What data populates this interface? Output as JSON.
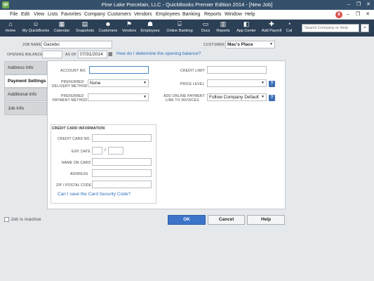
{
  "window": {
    "title": "Pine Lake Porcelain, LLC  - QuickBooks Premier Edition 2014 - [New Job]",
    "app_icon": "qb",
    "minimize": "–",
    "restore": "❐",
    "close": "✕"
  },
  "menu": {
    "items": [
      "File",
      "Edit",
      "View",
      "Lists",
      "Favorites",
      "Company",
      "Customers",
      "Vendors",
      "Employees",
      "Banking",
      "Reports",
      "Window",
      "Help"
    ],
    "alerts_count": "8",
    "right_controls": [
      "–",
      "❐",
      "✕"
    ]
  },
  "toolbar": {
    "items": [
      {
        "label": "Home",
        "icon": "⌂"
      },
      {
        "label": "My QuickBooks",
        "icon": "☺"
      },
      {
        "label": "Calendar",
        "icon": "▦"
      },
      {
        "label": "Snapshots",
        "icon": "▤"
      },
      {
        "label": "Customers",
        "icon": "☻"
      },
      {
        "label": "Vendors",
        "icon": "⚑"
      },
      {
        "label": "Employees",
        "icon": "☗"
      },
      {
        "label": "Online Banking",
        "icon": "⌸"
      },
      {
        "label": "Docs",
        "icon": "▭"
      },
      {
        "label": "Reports",
        "icon": "▥"
      },
      {
        "label": "App Center",
        "icon": "◧"
      },
      {
        "label": "Add Payroll",
        "icon": "✚"
      },
      {
        "label": "Cal",
        "icon": "◔"
      }
    ],
    "search_placeholder": "Search Company or Help",
    "search_button": "⌕"
  },
  "header": {
    "job_name_label": "JOB NAME",
    "job_name_value": "Gazebo",
    "customer_label": "CUSTOMER",
    "customer_value": "Mac's Place",
    "opening_balance_label": "OPENING BALANCE",
    "opening_balance_value": "",
    "as_of_label": "AS OF",
    "as_of_value": "07/31/2014",
    "calendar_icon": "▦",
    "help_link": "How do I determine the opening balance?"
  },
  "tabs": [
    {
      "label": "Address Info",
      "active": false
    },
    {
      "label": "Payment Settings",
      "active": true
    },
    {
      "label": "Additional Info",
      "active": false
    },
    {
      "label": "Job Info",
      "active": false
    }
  ],
  "payment": {
    "account_no_label": "ACCOUNT NO.",
    "account_no_value": "",
    "credit_limit_label": "CREDIT LIMIT",
    "credit_limit_value": "",
    "delivery_label_1": "PREFERRED",
    "delivery_label_2": "DELIVERY METHOD",
    "delivery_value": "None",
    "price_level_label": "PRICE LEVEL",
    "price_level_value": "",
    "payment_method_label_1": "PREFERRED",
    "payment_method_label_2": "PAYMENT METHOD",
    "payment_method_value": "",
    "online_payment_label_1": "ADD ONLINE PAYMENT",
    "online_payment_label_2": "LINK TO INVOICES",
    "online_payment_value": "Follow Company Default",
    "help_glyph": "?"
  },
  "credit_card": {
    "section_title": "CREDIT CARD INFORMATION",
    "card_no_label": "CREDIT CARD NO.",
    "exp_date_label": "EXP. DATE",
    "exp_separator": "/",
    "name_label": "NAME ON CARD",
    "address_label": "ADDRESS",
    "zip_label": "ZIP / POSTAL CODE",
    "security_link": "Can I save the Card Security Code?"
  },
  "footer": {
    "inactive_label": "Job is inactive",
    "ok": "OK",
    "cancel": "Cancel",
    "help": "Help"
  }
}
